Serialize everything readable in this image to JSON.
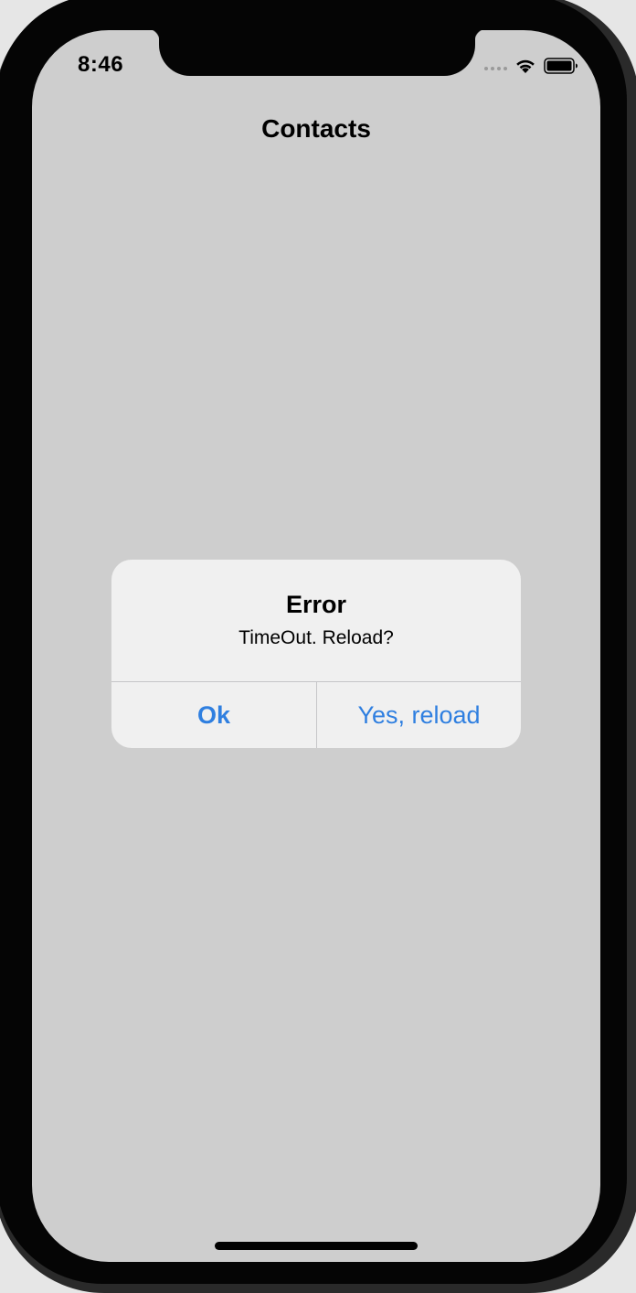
{
  "status_bar": {
    "time": "8:46"
  },
  "nav": {
    "title": "Contacts"
  },
  "alert": {
    "title": "Error",
    "message": "TimeOut. Reload?",
    "buttons": [
      {
        "label": "Ok"
      },
      {
        "label": "Yes, reload"
      }
    ]
  },
  "colors": {
    "screen_background": "#cecece",
    "alert_background": "#f0f0f0",
    "action_blue": "#2f7fe0"
  },
  "icons": [
    "signal-dots-icon",
    "wifi-icon",
    "battery-icon"
  ]
}
